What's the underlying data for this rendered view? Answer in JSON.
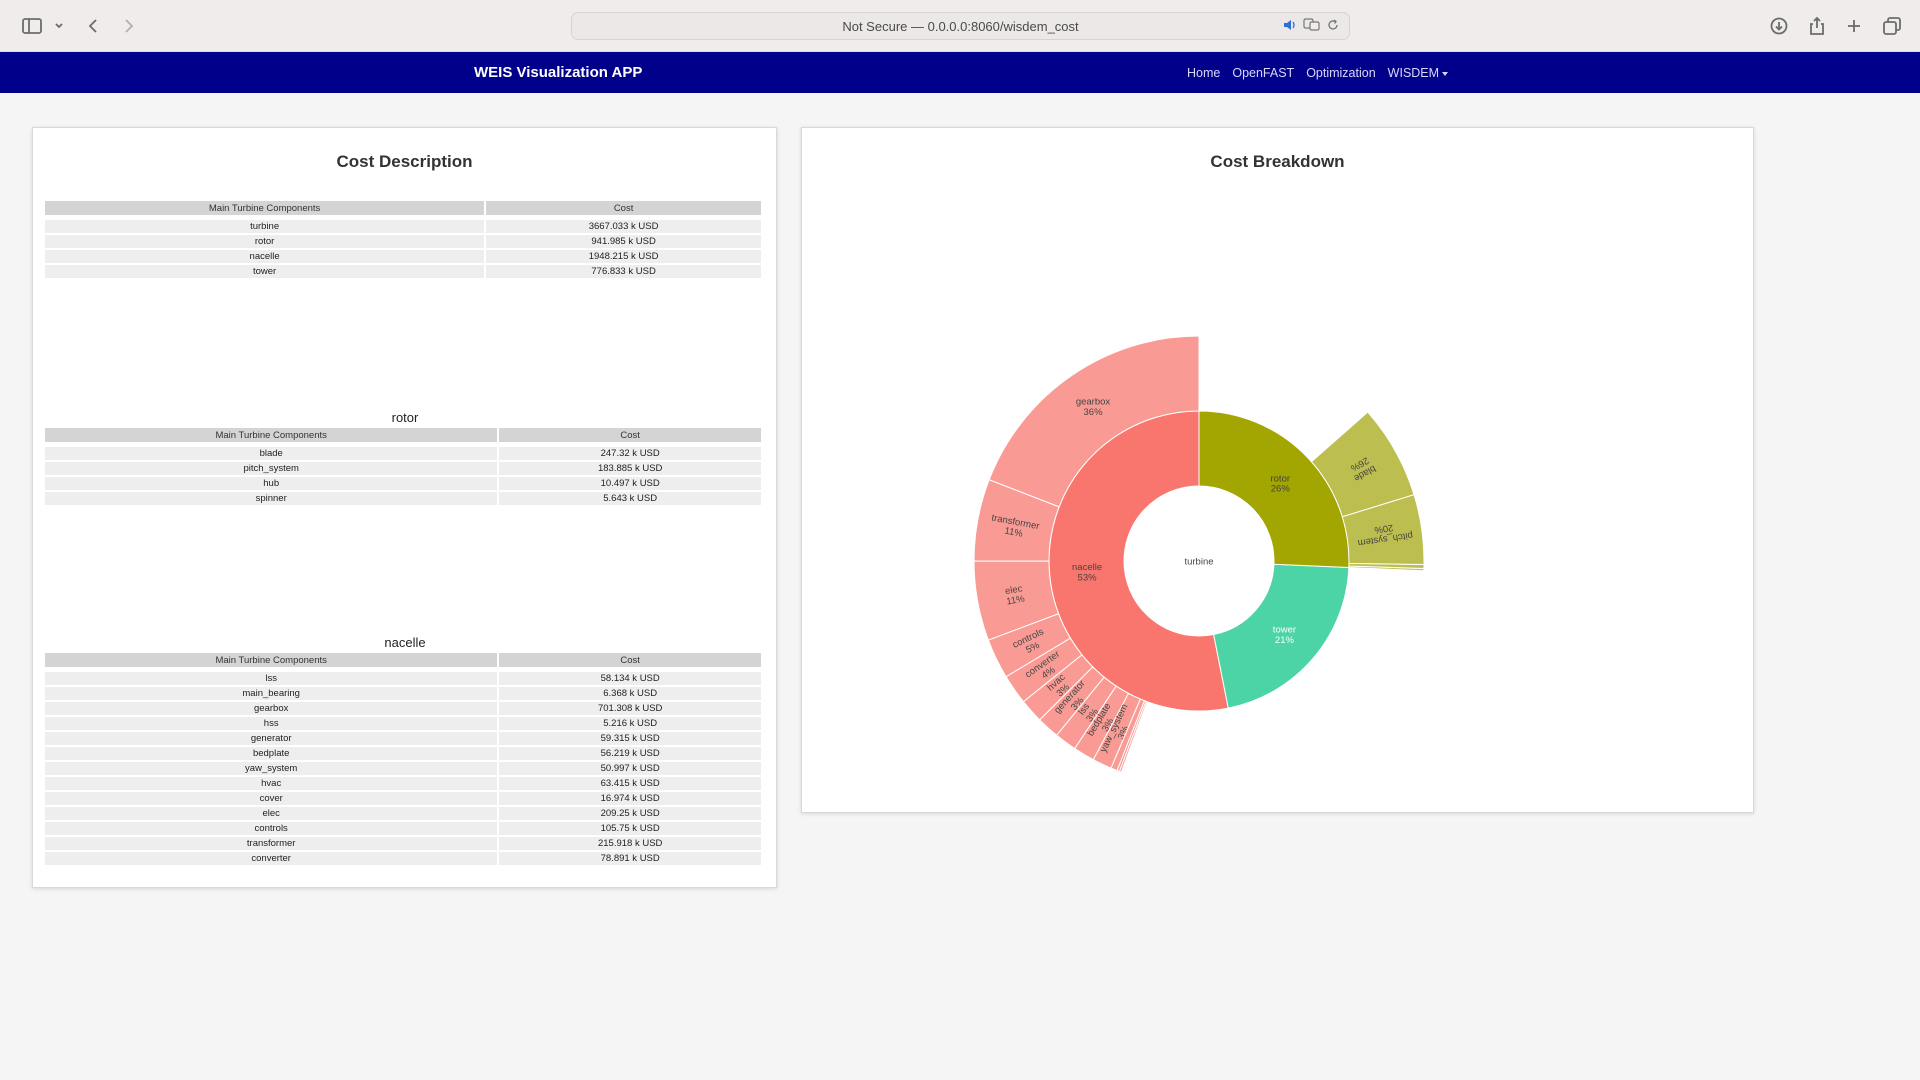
{
  "browser": {
    "url": "Not Secure — 0.0.0.0:8060/wisdem_cost"
  },
  "navbar": {
    "brand": "WEIS Visualization APP",
    "links": [
      "Home",
      "OpenFAST",
      "Optimization",
      "WISDEM"
    ]
  },
  "left_card": {
    "title": "Cost Description",
    "tables": [
      {
        "caption": "",
        "headers": [
          "Main Turbine Components",
          "Cost"
        ],
        "rows": [
          [
            "turbine",
            "3667.033 k USD"
          ],
          [
            "rotor",
            "941.985 k USD"
          ],
          [
            "nacelle",
            "1948.215 k USD"
          ],
          [
            "tower",
            "776.833 k USD"
          ]
        ]
      },
      {
        "caption": "rotor",
        "headers": [
          "Main Turbine Components",
          "Cost"
        ],
        "rows": [
          [
            "blade",
            "247.32 k USD"
          ],
          [
            "pitch_system",
            "183.885 k USD"
          ],
          [
            "hub",
            "10.497 k USD"
          ],
          [
            "spinner",
            "5.643 k USD"
          ]
        ]
      },
      {
        "caption": "nacelle",
        "headers": [
          "Main Turbine Components",
          "Cost"
        ],
        "rows": [
          [
            "lss",
            "58.134 k USD"
          ],
          [
            "main_bearing",
            "6.368 k USD"
          ],
          [
            "gearbox",
            "701.308 k USD"
          ],
          [
            "hss",
            "5.216 k USD"
          ],
          [
            "generator",
            "59.315 k USD"
          ],
          [
            "bedplate",
            "56.219 k USD"
          ],
          [
            "yaw_system",
            "50.997 k USD"
          ],
          [
            "hvac",
            "63.415 k USD"
          ],
          [
            "cover",
            "16.974 k USD"
          ],
          [
            "elec",
            "209.25 k USD"
          ],
          [
            "controls",
            "105.75 k USD"
          ],
          [
            "transformer",
            "215.918 k USD"
          ],
          [
            "converter",
            "78.891 k USD"
          ]
        ]
      }
    ]
  },
  "right_card": {
    "title": "Cost Breakdown"
  },
  "chart_data": {
    "type": "sunburst",
    "root": {
      "name": "turbine",
      "label": "turbine"
    },
    "rings": [
      [
        {
          "name": "nacelle",
          "value": 1948.215,
          "label": "nacelle",
          "pct": "53%",
          "color": "#f8766d"
        },
        {
          "name": "tower",
          "value": 776.833,
          "label": "tower",
          "pct": "21%",
          "color": "#4cd3a6"
        },
        {
          "name": "rotor",
          "value": 941.985,
          "label": "rotor",
          "pct": "26%",
          "color": "#a3a500"
        }
      ],
      [
        {
          "parent": "nacelle",
          "name": "gearbox",
          "value": 701.308,
          "label": "gearbox",
          "pct": "36%",
          "color": "#f99b94"
        },
        {
          "parent": "nacelle",
          "name": "transformer",
          "value": 215.918,
          "label": "transformer",
          "pct": "11%",
          "color": "#f99b94"
        },
        {
          "parent": "nacelle",
          "name": "elec",
          "value": 209.25,
          "label": "elec",
          "pct": "11%",
          "color": "#f99b94"
        },
        {
          "parent": "nacelle",
          "name": "controls",
          "value": 105.75,
          "label": "controls",
          "pct": "5%",
          "color": "#f99b94"
        },
        {
          "parent": "nacelle",
          "name": "converter",
          "value": 78.891,
          "label": "converter",
          "pct": "4%",
          "color": "#f99b94"
        },
        {
          "parent": "nacelle",
          "name": "hvac",
          "value": 63.415,
          "label": "hvac",
          "pct": "3%",
          "color": "#f99b94"
        },
        {
          "parent": "nacelle",
          "name": "generator",
          "value": 59.315,
          "label": "generator",
          "pct": "3%",
          "color": "#f99b94"
        },
        {
          "parent": "nacelle",
          "name": "lss",
          "value": 58.134,
          "label": "lss",
          "pct": "3%",
          "color": "#f99b94"
        },
        {
          "parent": "nacelle",
          "name": "bedplate",
          "value": 56.219,
          "label": "bedplate",
          "pct": "3%",
          "color": "#f99b94"
        },
        {
          "parent": "nacelle",
          "name": "yaw_system",
          "value": 50.997,
          "label": "yaw_system",
          "pct": "3%",
          "color": "#f99b94"
        },
        {
          "parent": "nacelle",
          "name": "cover",
          "value": 16.974,
          "label": "",
          "pct": "",
          "color": "#f99b94"
        },
        {
          "parent": "nacelle",
          "name": "main_bearing",
          "value": 6.368,
          "label": "",
          "pct": "",
          "color": "#f99b94"
        },
        {
          "parent": "nacelle",
          "name": "hss",
          "value": 5.216,
          "label": "",
          "pct": "",
          "color": "#f99b94"
        },
        {
          "parent": "rotor",
          "name": "spinner",
          "value": 5.643,
          "label": "",
          "pct": "",
          "color": "#bcbe4f"
        },
        {
          "parent": "rotor",
          "name": "hub",
          "value": 10.497,
          "label": "",
          "pct": "",
          "color": "#bcbe4f"
        },
        {
          "parent": "rotor",
          "name": "pitch_system",
          "value": 183.885,
          "label": "pitch_system",
          "pct": "20%",
          "color": "#bcbe4f"
        },
        {
          "parent": "rotor",
          "name": "blade",
          "value": 247.32,
          "label": "blade",
          "pct": "26%",
          "color": "#bcbe4f"
        }
      ]
    ]
  }
}
